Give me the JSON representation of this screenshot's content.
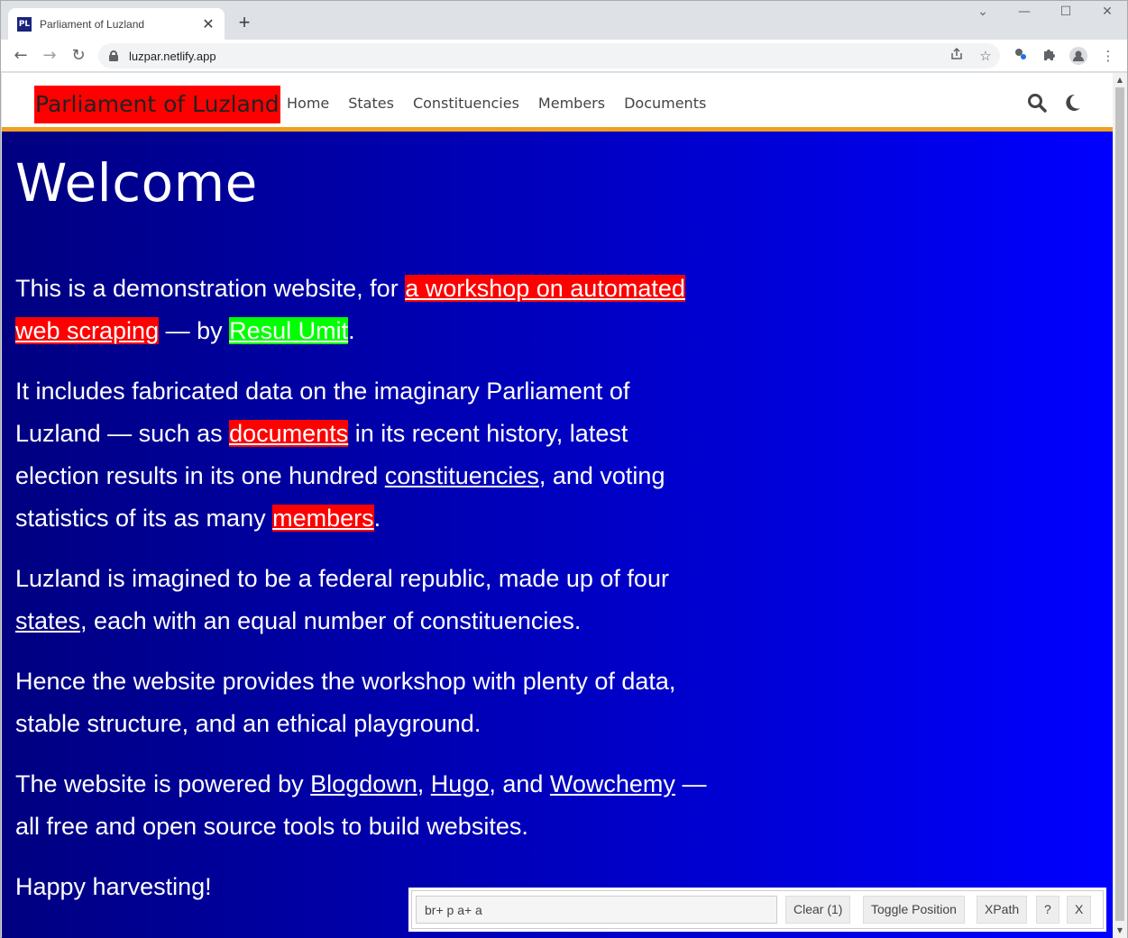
{
  "browser": {
    "tab_title": "Parliament of Luzland",
    "favicon_text": "PL",
    "tab_close": "✕",
    "new_tab": "+",
    "url": "luzpar.netlify.app",
    "window_controls": [
      "⌄",
      "—",
      "☐",
      "✕"
    ],
    "nav_icons": [
      "←",
      "→",
      "↻"
    ],
    "toolbar_icons": [
      "share-icon",
      "star-icon",
      "extension-gadget-icon",
      "puzzle-icon",
      "profile-icon",
      "menu-icon"
    ]
  },
  "site": {
    "brand": "Parliament of Luzland",
    "nav": [
      "Home",
      "States",
      "Constituencies",
      "Members",
      "Documents"
    ],
    "colors": {
      "brand_bg": "#ff0000",
      "header_border": "#f0a020",
      "gradient_left": "#000080",
      "gradient_right": "#0000ff",
      "highlight_red": "#ff0000",
      "highlight_green": "#00ff00"
    }
  },
  "content": {
    "title": "Welcome",
    "p1": {
      "t1": "This is a demonstration website, for ",
      "link1": "a workshop on automated web scraping",
      "t2": " — by ",
      "link2": "Resul Umit",
      "t3": "."
    },
    "p2": {
      "t1": "It includes fabricated data on the imaginary Parliament of Luzland — such as ",
      "link1": "documents",
      "t2": " in its recent history, latest election results in its one hundred ",
      "link2": "constituencies",
      "t3": ", and voting statistics of its as many ",
      "link3": "members",
      "t4": "."
    },
    "p3": {
      "t1": "Luzland is imagined to be a federal republic, made up of four ",
      "link1": "states",
      "t2": ", each with an equal number of constituencies."
    },
    "p4": "Hence the website provides the workshop with plenty of data, stable structure, and an ethical playground.",
    "p5": {
      "t1": "The website is powered by ",
      "link1": "Blogdown",
      "t2": ", ",
      "link2": "Hugo",
      "t3": ", and ",
      "link3": "Wowchemy",
      "t4": " — all free and open source tools to build websites."
    },
    "p6": "Happy harvesting!"
  },
  "gadget": {
    "selector": "br+ p a+ a",
    "clear": "Clear (1)",
    "toggle": "Toggle Position",
    "xpath": "XPath",
    "help": "?",
    "close": "X"
  }
}
